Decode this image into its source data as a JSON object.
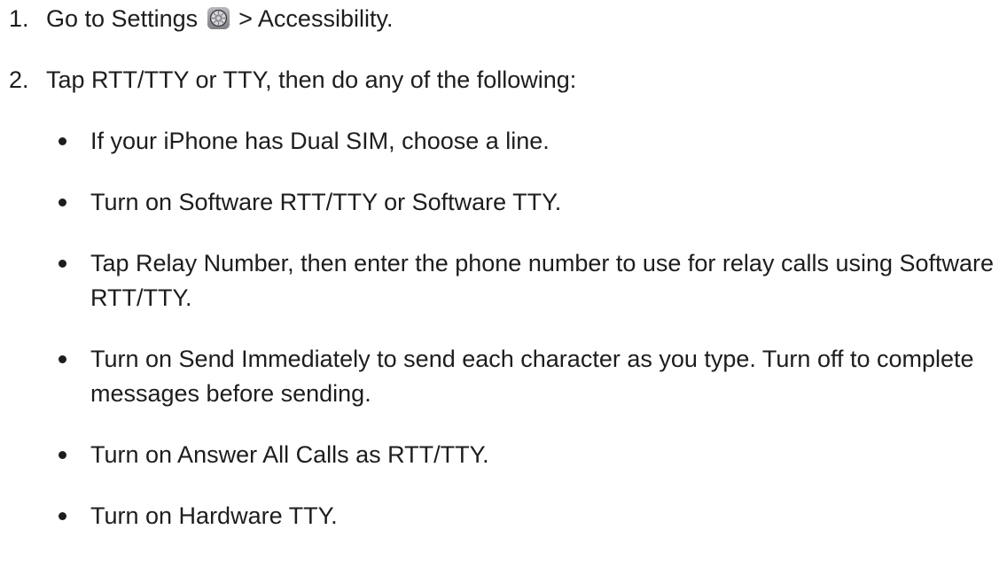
{
  "steps": [
    {
      "number": "1.",
      "text_before": "Go to Settings",
      "icon": "settings-gear-icon",
      "text_after": "> Accessibility."
    },
    {
      "number": "2.",
      "text": "Tap RTT/TTY or TTY, then do any of the following:",
      "bullets": [
        "If your iPhone has Dual SIM, choose a line.",
        "Turn on Software RTT/TTY or Software TTY.",
        "Tap Relay Number, then enter the phone number to use for relay calls using Software RTT/TTY.",
        "Turn on Send Immediately to send each character as you type. Turn off to complete messages before sending.",
        "Turn on Answer All Calls as RTT/TTY.",
        "Turn on Hardware TTY."
      ]
    }
  ],
  "colors": {
    "text": "#1d1d1f",
    "background": "#ffffff",
    "icon_gray": "#8e8e93"
  }
}
